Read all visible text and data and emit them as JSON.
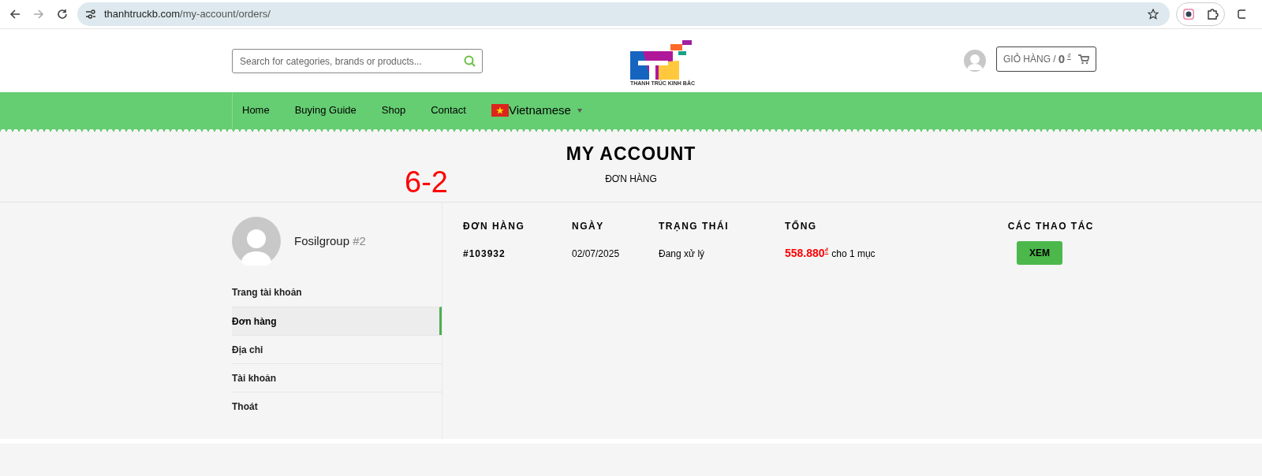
{
  "browser": {
    "url_host": "thanhtruckb.com",
    "url_path": "/my-account/orders/"
  },
  "header": {
    "search": {
      "placeholder": "Search for categories, brands or products..."
    },
    "logo_text": "THANH TRÚC KINH BẮC",
    "cart": {
      "label": "GIỎ HÀNG /",
      "amount": "0",
      "currency": "₫"
    }
  },
  "nav": {
    "items": [
      {
        "label": "Home",
        "kind": "link"
      },
      {
        "label": "Buying Guide",
        "kind": "link"
      },
      {
        "label": "Shop",
        "kind": "link"
      },
      {
        "label": "Contact",
        "kind": "link"
      },
      {
        "label": "Vietnamese",
        "kind": "language"
      }
    ]
  },
  "page_title": {
    "title": "MY ACCOUNT",
    "subtitle": "ĐƠN HÀNG"
  },
  "annotation": "6-2",
  "account": {
    "name": "Fosilgroup",
    "number": "#2"
  },
  "sidebar": {
    "items": [
      {
        "label": "Trang tài khoản",
        "selected": false
      },
      {
        "label": "Đơn hàng",
        "selected": true
      },
      {
        "label": "Địa chỉ",
        "selected": false
      },
      {
        "label": "Tài khoản",
        "selected": false
      },
      {
        "label": "Thoát",
        "selected": false
      }
    ]
  },
  "orders": {
    "columns": [
      "ĐƠN HÀNG",
      "NGÀY",
      "TRẠNG THÁI",
      "TỔNG",
      "CÁC THAO TÁC"
    ],
    "rows": [
      {
        "order": "#103932",
        "date": "02/07/2025",
        "status": "Đang xử lý",
        "total": "558.880",
        "currency": "₫",
        "items": "cho 1 mục",
        "action": "XEM"
      }
    ]
  }
}
